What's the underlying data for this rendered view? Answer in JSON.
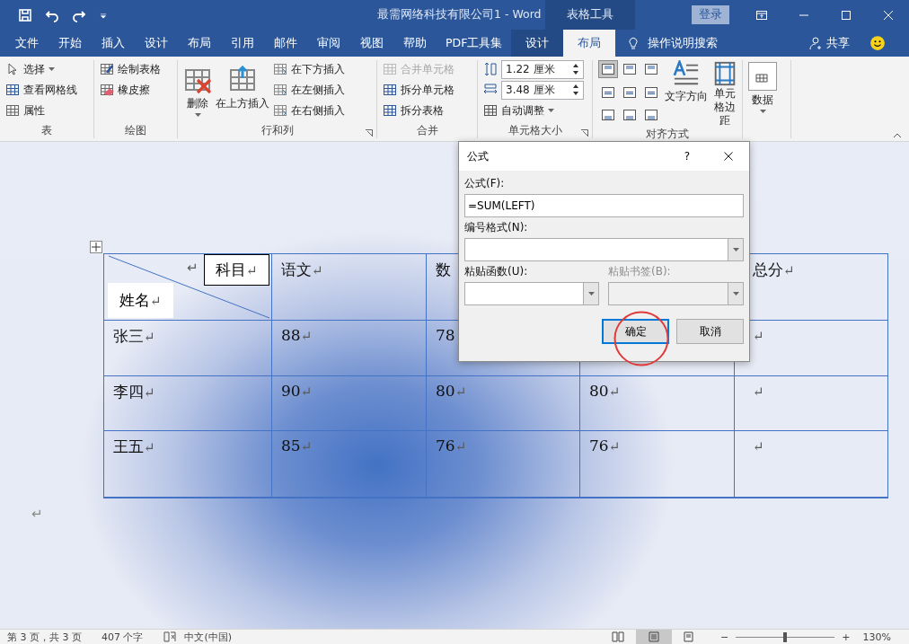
{
  "title_bar": {
    "title": "最需网络科技有限公司1  -  Word",
    "context_label": "表格工具",
    "sign_in": "登录"
  },
  "tabs": [
    {
      "label": "文件",
      "selected": false,
      "context": false
    },
    {
      "label": "开始",
      "selected": false,
      "context": false
    },
    {
      "label": "插入",
      "selected": false,
      "context": false
    },
    {
      "label": "设计",
      "selected": false,
      "context": false
    },
    {
      "label": "布局",
      "selected": false,
      "context": false
    },
    {
      "label": "引用",
      "selected": false,
      "context": false
    },
    {
      "label": "邮件",
      "selected": false,
      "context": false
    },
    {
      "label": "审阅",
      "selected": false,
      "context": false
    },
    {
      "label": "视图",
      "selected": false,
      "context": false
    },
    {
      "label": "帮助",
      "selected": false,
      "context": false
    },
    {
      "label": "PDF工具集",
      "selected": false,
      "context": false
    },
    {
      "label": "设计",
      "selected": false,
      "context": true
    },
    {
      "label": "布局",
      "selected": true,
      "context": true
    }
  ],
  "tell_me": "操作说明搜索",
  "share": "共享",
  "ribbon": {
    "table": {
      "label": "表",
      "items": [
        {
          "label": "选择",
          "dropdown": true
        },
        {
          "label": "查看网格线"
        },
        {
          "label": "属性"
        }
      ]
    },
    "draw": {
      "label": "绘图",
      "items": [
        {
          "label": "绘制表格"
        },
        {
          "label": "橡皮擦"
        }
      ]
    },
    "rows_cols": {
      "label": "行和列",
      "delete": "删除",
      "insert_above": "在上方插入",
      "items": [
        {
          "label": "在下方插入"
        },
        {
          "label": "在左侧插入"
        },
        {
          "label": "在右侧插入"
        }
      ]
    },
    "merge": {
      "label": "合并",
      "items": [
        {
          "label": "合并单元格",
          "disabled": true
        },
        {
          "label": "拆分单元格",
          "disabled": false
        },
        {
          "label": "拆分表格",
          "disabled": false
        }
      ]
    },
    "cell_size": {
      "label": "单元格大小",
      "height": "1.22 厘米",
      "width": "3.48 厘米",
      "autofit": "自动调整"
    },
    "alignment": {
      "label": "对齐方式",
      "cells": [
        {
          "selected": true
        },
        {
          "selected": false
        },
        {
          "selected": false
        },
        {
          "selected": false
        },
        {
          "selected": false
        },
        {
          "selected": false
        },
        {
          "selected": false
        },
        {
          "selected": false
        },
        {
          "selected": false
        }
      ],
      "text_direction": "文字方向",
      "cell_margins": "单元格边距"
    },
    "data": {
      "label": "数据"
    }
  },
  "table": {
    "header": [
      {
        "text": "语文",
        "mark": "↵"
      },
      {
        "text": "数"
      },
      {
        "text": "总分",
        "mark": "↵"
      }
    ],
    "corner": {
      "top": "科目",
      "bottom": "姓名",
      "mark": "↵"
    },
    "rows": [
      [
        {
          "text": "张三",
          "mark": "↵"
        },
        {
          "text": "88",
          "mark": "↵"
        },
        {
          "text": "78"
        },
        "",
        {
          "mark": "↵"
        }
      ],
      [
        {
          "text": "李四",
          "mark": "↵"
        },
        {
          "text": "90",
          "mark": "↵"
        },
        {
          "text": "80",
          "mark": "↵"
        },
        {
          "text": "80",
          "mark": "↵"
        },
        {
          "mark": "↵"
        }
      ],
      [
        {
          "text": "王五",
          "mark": "↵"
        },
        {
          "text": "85",
          "mark": "↵"
        },
        {
          "text": "76",
          "mark": "↵"
        },
        {
          "text": "76",
          "mark": "↵"
        },
        {
          "mark": "↵"
        }
      ]
    ],
    "after_mark": "↵"
  },
  "dialog": {
    "title": "公式",
    "help": "?",
    "formula_label": "公式(F):",
    "formula": "=SUM(LEFT)",
    "format_label": "编号格式(N):",
    "function_label": "粘贴函数(U):",
    "bookmark_label": "粘贴书签(B):",
    "bookmark_disabled": true,
    "ok": "确定",
    "cancel": "取消"
  },
  "status_bar": {
    "page": "第 3 页，共 3 页",
    "words": "407 个字",
    "language": "中文(中国)",
    "views": [
      {
        "selected": false
      },
      {
        "selected": true
      },
      {
        "selected": false
      }
    ],
    "zoom_minus": "−",
    "zoom_plus": "+",
    "zoom_slider": {
      "level": 0.5
    },
    "zoom": "130%"
  }
}
